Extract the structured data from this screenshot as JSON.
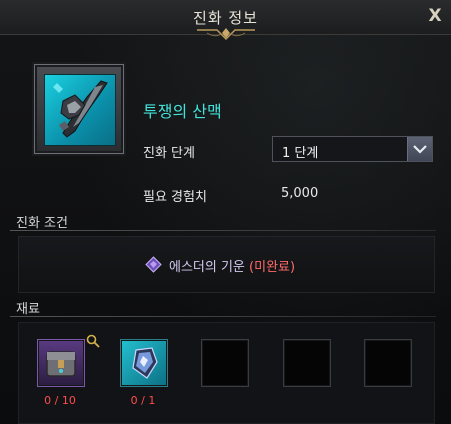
{
  "window": {
    "title": "진화 정보",
    "close_label": "X"
  },
  "item": {
    "name": "투쟁의 산맥",
    "icon": "spear-weapon-icon"
  },
  "evolution": {
    "stage_label": "진화 단계",
    "stage_selected": "1 단계",
    "exp_label": "필요 경험치",
    "exp_value": "5,000"
  },
  "conditions": {
    "section_title": "진화 조건",
    "requirement_name": "에스더의 기운",
    "requirement_status": "(미완료)",
    "status_color": "#ff6b6b"
  },
  "materials": {
    "section_title": "재료",
    "slots": [
      {
        "icon": "treasure-chest-icon",
        "count": "0 / 10"
      },
      {
        "icon": "crystal-shard-icon",
        "count": "0 / 1"
      },
      {
        "icon": "empty-slot",
        "count": ""
      },
      {
        "icon": "empty-slot",
        "count": ""
      },
      {
        "icon": "empty-slot",
        "count": ""
      }
    ]
  },
  "colors": {
    "item_name": "#43e3d9",
    "requirement_text": "#d4c9f0",
    "count_red": "#ff4b4b"
  }
}
